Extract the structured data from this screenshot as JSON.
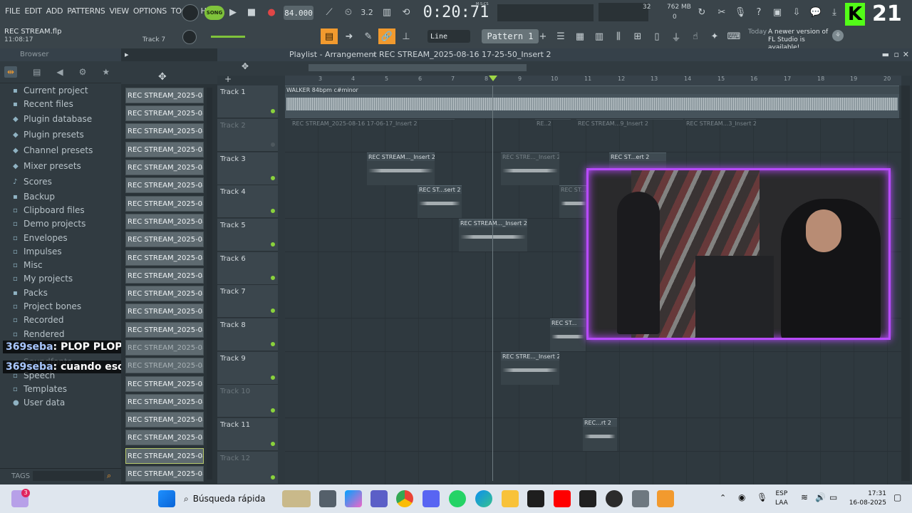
{
  "menu": [
    "FILE",
    "EDIT",
    "ADD",
    "PATTERNS",
    "VIEW",
    "OPTIONS",
    "TOOLS",
    "HELP"
  ],
  "transport": {
    "song_label": "SONG",
    "tempo": "84.000",
    "time": "0:20:71",
    "time_unit": "M:S:CS",
    "pattern": "Pattern 1",
    "snap": "Line",
    "cpu": "32",
    "memory": "762 MB",
    "voices": "0"
  },
  "project": {
    "file": "REC STREAM.flp",
    "time": "11:08:17",
    "track_hint": "Track 7"
  },
  "news": {
    "title": "Today",
    "text": "A newer version of FL Studio is available!"
  },
  "browser": {
    "title": "Browser",
    "tags_label": "TAGS",
    "items": [
      "Current project",
      "Recent files",
      "Plugin database",
      "Plugin presets",
      "Channel presets",
      "Mixer presets",
      "Scores",
      "Backup",
      "Clipboard files",
      "Demo projects",
      "Envelopes",
      "Impulses",
      "Misc",
      "My projects",
      "Packs",
      "Project bones",
      "Recorded",
      "Rendered",
      "Soundfonts",
      "Speech",
      "Templates",
      "User data"
    ]
  },
  "clips": {
    "label": "REC STREAM_2025-08-16..."
  },
  "playlist": {
    "title": "Playlist - Arrangement",
    "breadcrumb": "REC STREAM_2025-08-16 17-25-50_Insert 2",
    "ruler": [
      "3",
      "4",
      "5",
      "6",
      "7",
      "8",
      "9",
      "10",
      "11",
      "12",
      "13",
      "14",
      "15",
      "16",
      "17",
      "18",
      "19",
      "20"
    ],
    "tracks": [
      "Track 1",
      "Track 2",
      "Track 3",
      "Track 4",
      "Track 5",
      "Track 6",
      "Track 7",
      "Track 8",
      "Track 9",
      "Track 10",
      "Track 11",
      "Track 12"
    ],
    "patterns": {
      "p1": "WALKER 84bpm c#minor",
      "p2": "REC STREAM_2025-08-16 17-06-17_Insert 2",
      "p3": "RE..2",
      "p4": "REC STREAM...9_Insert 2",
      "p5": "REC STREAM...3_Insert 2",
      "p6": "REC STREAM..._Insert 2",
      "p7": "REC STRE..._Insert 2",
      "p8": "REC ST...ert 2",
      "p9": "REC ST...sert 2",
      "p10": "REC ST...",
      "p11": "REC STREAM..._Insert 2",
      "p12": "REC ST...",
      "p13": "REC STRE..._Insert 2",
      "p14": "REC...rt 2"
    }
  },
  "chat": [
    {
      "user": "369seba",
      "msg": ": PLOP PLOP"
    },
    {
      "user": "369seba",
      "msg": ": cuando eso?"
    }
  ],
  "overlay_number": "21",
  "taskbar": {
    "search": "Búsqueda rápida",
    "lang": "ESP",
    "lang2": "LAA",
    "time": "17:31",
    "date": "16-08-2025",
    "badge": "3"
  },
  "colors": {
    "accent": "#b84bff",
    "green": "#8ad23c",
    "orange": "#f29a2e"
  }
}
